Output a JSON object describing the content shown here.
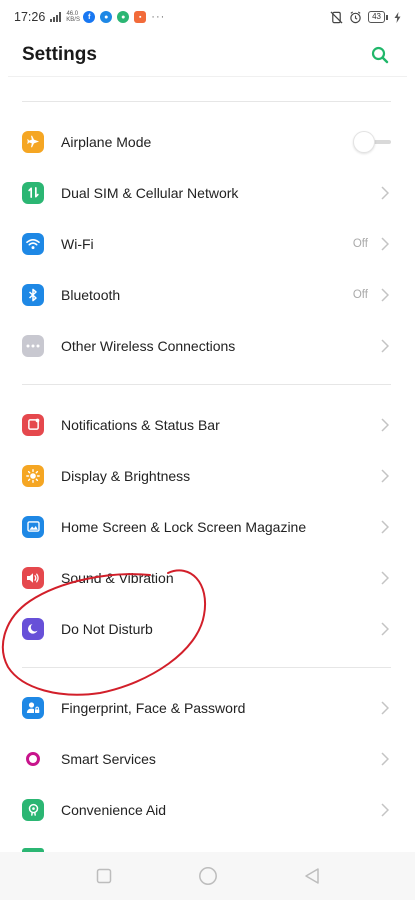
{
  "status_bar": {
    "time": "17:26",
    "network_speed_value": "46.0",
    "network_speed_unit": "KB/S",
    "more_indicator": "···",
    "battery_level": "43"
  },
  "header": {
    "title": "Settings"
  },
  "colors": {
    "accent": "#20b76a",
    "airplane": "#f5a623",
    "sim": "#2bb673",
    "wifi": "#1e88e5",
    "bluetooth": "#1e88e5",
    "other_wireless": "#c8c8d0",
    "notifications": "#e5484d",
    "display": "#f5a623",
    "home_screen": "#1e88e5",
    "sound": "#e5484d",
    "dnd": "#6750d8",
    "fingerprint": "#1e88e5",
    "smart_services": "#c8148c",
    "convenience": "#2bb673",
    "annotation": "#d21f2a"
  },
  "settings": {
    "airplane_mode": {
      "label": "Airplane Mode",
      "icon": "airplane-icon",
      "toggle_on": false
    },
    "dual_sim": {
      "label": "Dual SIM & Cellular Network",
      "icon": "sim-icon"
    },
    "wifi": {
      "label": "Wi-Fi",
      "value": "Off",
      "icon": "wifi-icon"
    },
    "bluetooth": {
      "label": "Bluetooth",
      "value": "Off",
      "icon": "bluetooth-icon"
    },
    "other_wireless": {
      "label": "Other Wireless Connections",
      "icon": "more-icon"
    },
    "notifications": {
      "label": "Notifications & Status Bar",
      "icon": "notification-icon"
    },
    "display": {
      "label": "Display & Brightness",
      "icon": "sun-icon"
    },
    "home_screen": {
      "label": "Home Screen & Lock Screen Magazine",
      "icon": "picture-icon"
    },
    "sound": {
      "label": "Sound & Vibration",
      "icon": "speaker-icon"
    },
    "do_not_disturb": {
      "label": "Do Not Disturb",
      "icon": "moon-icon"
    },
    "fingerprint": {
      "label": "Fingerprint, Face & Password",
      "icon": "user-lock-icon"
    },
    "smart_services": {
      "label": "Smart Services",
      "icon": "ring-icon"
    },
    "convenience_aid": {
      "label": "Convenience Aid",
      "icon": "hand-icon"
    }
  }
}
